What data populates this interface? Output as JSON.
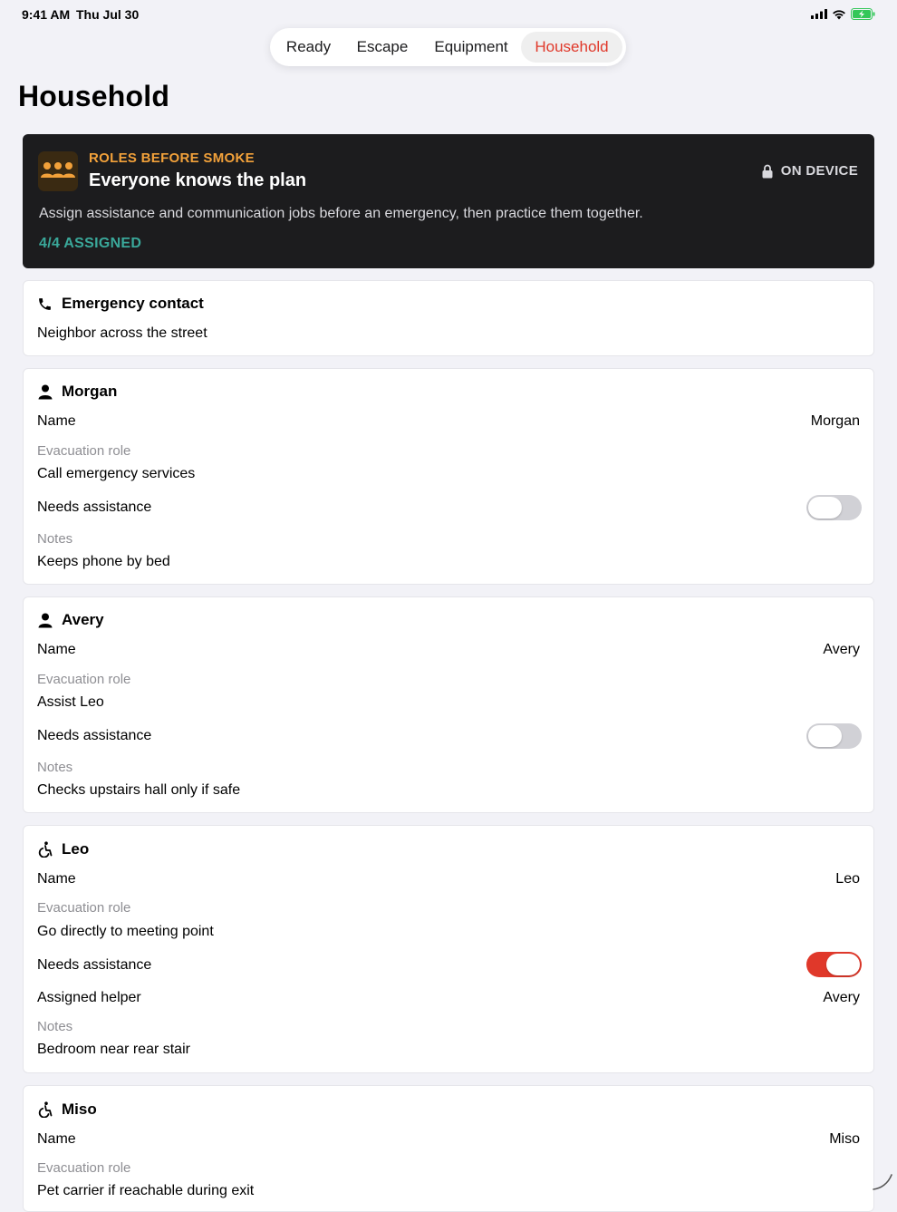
{
  "status": {
    "time": "9:41 AM",
    "date": "Thu Jul 30"
  },
  "tabs": [
    {
      "label": "Ready",
      "active": false
    },
    {
      "label": "Escape",
      "active": false
    },
    {
      "label": "Equipment",
      "active": false
    },
    {
      "label": "Household",
      "active": true
    }
  ],
  "page_title": "Household",
  "hero": {
    "icon": "people-icon",
    "kicker": "ROLES BEFORE SMOKE",
    "title": "Everyone knows the plan",
    "description": "Assign assistance and communication jobs before an emergency, then practice them together.",
    "count": "4/4 ASSIGNED",
    "badge": "ON DEVICE",
    "badge_icon": "lock-icon"
  },
  "emergency": {
    "icon": "phone-icon",
    "title": "Emergency contact",
    "value": "Neighbor across the street"
  },
  "labels": {
    "name": "Name",
    "role": "Evacuation role",
    "needs": "Needs assistance",
    "helper": "Assigned helper",
    "notes": "Notes"
  },
  "members": [
    {
      "icon": "person-icon",
      "heading": "Morgan",
      "name": "Morgan",
      "role": "Call emergency services",
      "needs_assistance": false,
      "notes": "Keeps phone by bed"
    },
    {
      "icon": "person-icon",
      "heading": "Avery",
      "name": "Avery",
      "role": "Assist Leo",
      "needs_assistance": false,
      "notes": "Checks upstairs hall only if safe"
    },
    {
      "icon": "accessibility-icon",
      "heading": "Leo",
      "name": "Leo",
      "role": "Go directly to meeting point",
      "needs_assistance": true,
      "helper": "Avery",
      "notes": "Bedroom near rear stair"
    },
    {
      "icon": "accessibility-icon",
      "heading": "Miso",
      "name": "Miso",
      "role": "Pet carrier if reachable during exit"
    }
  ],
  "colors": {
    "accent": "#e0382a",
    "kicker": "#f2a13a",
    "count": "#3aa89a",
    "hero_bg": "#1c1c1e",
    "background": "#f2f2f7"
  }
}
